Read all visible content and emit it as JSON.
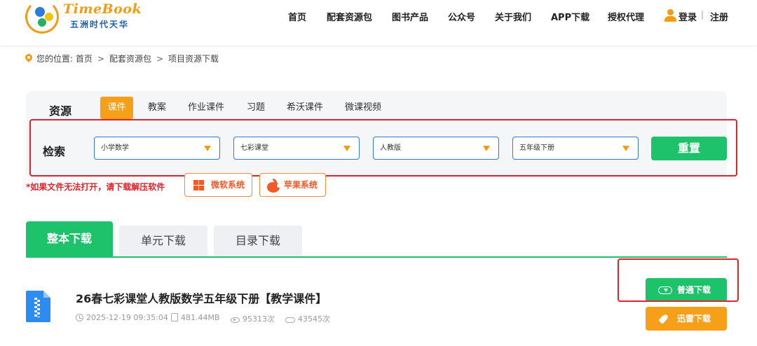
{
  "header": {
    "logo_text": "TimeBook",
    "logo_sub": "五洲时代天华",
    "nav": [
      "首页",
      "配套资源包",
      "图书产品",
      "公众号",
      "关于我们",
      "APP下载",
      "授权代理"
    ],
    "login": "登录",
    "separator": "|",
    "register": "注册"
  },
  "breadcrumb": {
    "prefix": "您的位置:",
    "items": [
      "首页",
      "配套资源包",
      "项目资源下载"
    ],
    "arrow": ">"
  },
  "filter": {
    "resource_label": "资源",
    "resource_tabs": [
      "课件",
      "教案",
      "作业课件",
      "习题",
      "希沃课件",
      "微课视频"
    ],
    "active_tab": "课件",
    "search_label": "检索",
    "selects": [
      "小学数学",
      "七彩课堂",
      "人教版",
      "五年级下册"
    ],
    "reset_label": "重置"
  },
  "notice": {
    "text": "*如果文件无法打开，请下载解压软件",
    "windows_label": "微软系统",
    "apple_label": "苹果系统"
  },
  "download_tabs": [
    "整本下载",
    "单元下载",
    "目录下载"
  ],
  "file": {
    "title": "26春七彩课堂人教版数学五年级下册【教学课件】",
    "date": "2025-12-19 09:35:04",
    "size": "481.44MB",
    "views": "95313次",
    "downloads": "43545次",
    "normal_download": "普通下载",
    "fast_download": "迅雷下载"
  },
  "colors": {
    "accent_orange": "#f6a01a",
    "accent_green": "#1ec26a",
    "select_border": "#2d7ad8",
    "highlight_red": "#e1232b"
  }
}
